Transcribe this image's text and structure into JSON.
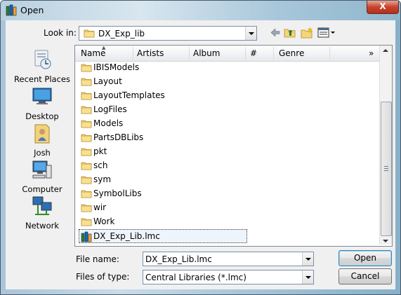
{
  "window": {
    "title": "Open",
    "close_label": "X"
  },
  "look_in": {
    "label": "Look in:",
    "value": "DX_Exp_lib"
  },
  "places": [
    {
      "label": "Recent Places",
      "icon": "recent-places-icon"
    },
    {
      "label": "Desktop",
      "icon": "desktop-icon"
    },
    {
      "label": "Josh",
      "icon": "user-folder-icon"
    },
    {
      "label": "Computer",
      "icon": "computer-icon"
    },
    {
      "label": "Network",
      "icon": "network-icon"
    }
  ],
  "columns": {
    "name": "Name",
    "artists": "Artists",
    "album": "Album",
    "number": "#",
    "genre": "Genre",
    "more": "»"
  },
  "files": [
    {
      "name": "IBISModels",
      "type": "folder"
    },
    {
      "name": "Layout",
      "type": "folder"
    },
    {
      "name": "LayoutTemplates",
      "type": "folder"
    },
    {
      "name": "LogFiles",
      "type": "folder"
    },
    {
      "name": "Models",
      "type": "folder"
    },
    {
      "name": "PartsDBLibs",
      "type": "folder"
    },
    {
      "name": "pkt",
      "type": "folder"
    },
    {
      "name": "sch",
      "type": "folder"
    },
    {
      "name": "sym",
      "type": "folder"
    },
    {
      "name": "SymbolLibs",
      "type": "folder"
    },
    {
      "name": "wir",
      "type": "folder"
    },
    {
      "name": "Work",
      "type": "folder"
    },
    {
      "name": "DX_Exp_Lib.lmc",
      "type": "lmc-file",
      "selected": true
    }
  ],
  "file_name": {
    "label": "File name:",
    "value": "DX_Exp_Lib.lmc"
  },
  "file_type": {
    "label": "Files of type:",
    "value": "Central Libraries (*.lmc)"
  },
  "buttons": {
    "open": "Open",
    "cancel": "Cancel"
  }
}
